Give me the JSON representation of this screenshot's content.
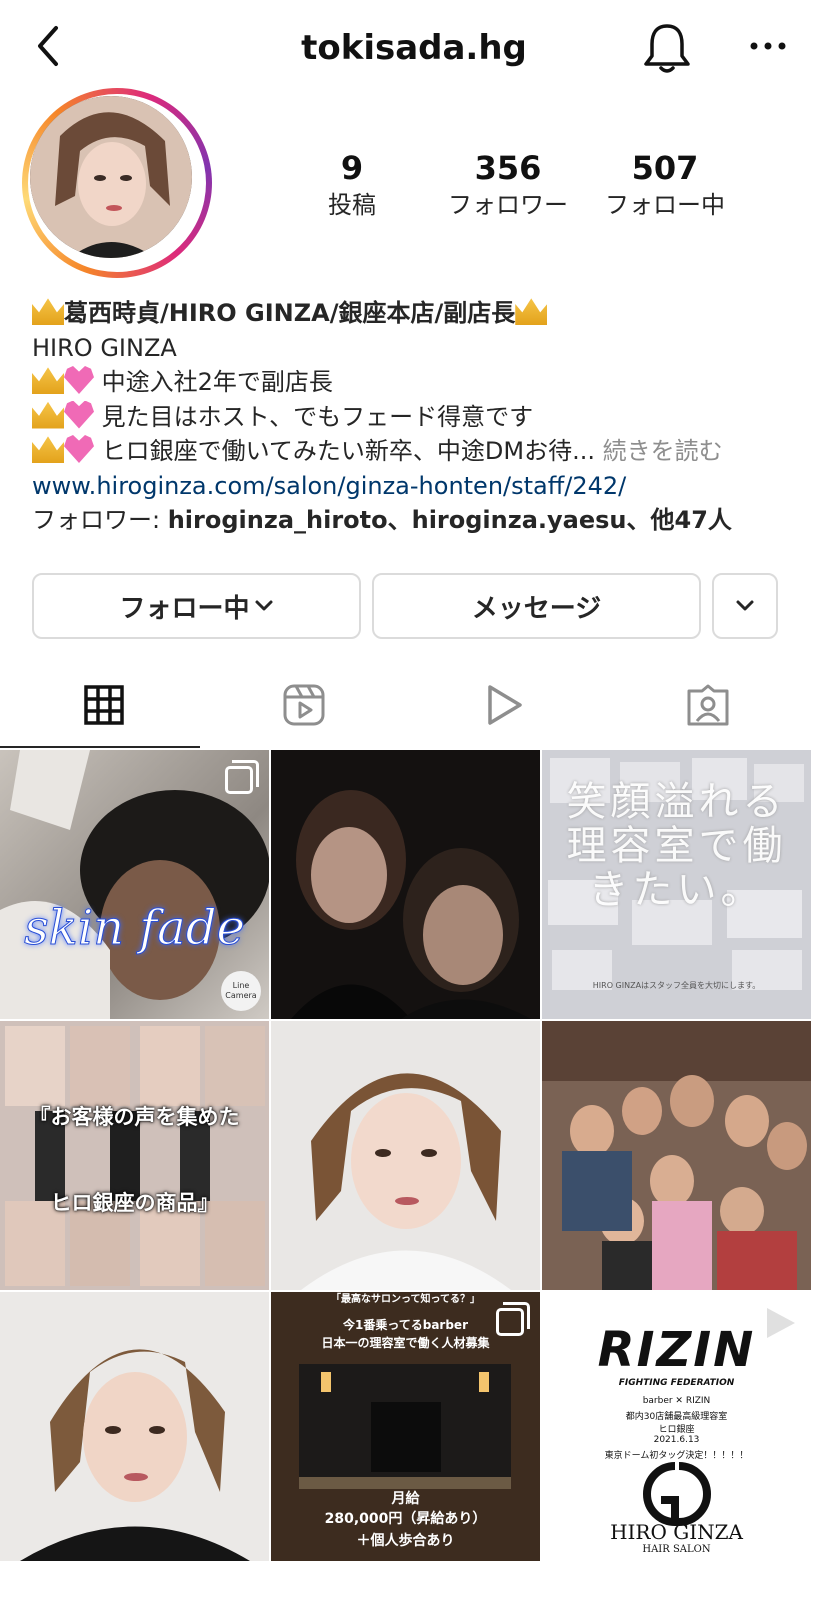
{
  "header": {
    "username": "tokisada.hg"
  },
  "stats": [
    {
      "value": "9",
      "label": "投稿"
    },
    {
      "value": "356",
      "label": "フォロワー"
    },
    {
      "value": "507",
      "label": "フォロー中"
    }
  ],
  "bio": {
    "name": "葛西時貞/HIRO GINZA/銀座本店/副店長",
    "category": "HIRO GINZA",
    "line1": "中途入社2年で副店長",
    "line2": "見た目はホスト、でもフェード得意です",
    "line3": "ヒロ銀座で働いてみたい新卒、中途DMお待...",
    "more": " 続きを読む",
    "link": "www.hiroginza.com/salon/ginza-honten/staff/242/",
    "followed_prefix": "フォロワー: ",
    "followed_names": "hiroginza_hiroto、hiroginza.yaesu、他47人"
  },
  "buttons": {
    "following": "フォロー中",
    "message": "メッセージ"
  },
  "posts": {
    "p1_text": "skin fade",
    "p1_badge": "Line Camera",
    "p3_text": "笑顔溢れる理容室で働きたい。",
    "p3_sub": "HIRO GINZAはスタッフ全員を大切にします。",
    "p4_top": "『お客様の声を集めた",
    "p4_bottom": "ヒロ銀座の商品』",
    "p8_top": "「最高なサロンって知ってる？」",
    "p8_l1": "今1番乗ってるbarber",
    "p8_l2": "日本一の理容室で働く人材募集",
    "p8_l3": "月給",
    "p8_l4": "280,000円（昇給あり）",
    "p8_l5": "＋個人歩合あり",
    "p9_logo": "RIZIN",
    "p9_sub": "FIGHTING FEDERATION",
    "p9_l1": "barber ✕ RIZIN",
    "p9_l2": "都内30店舗最高級理容室",
    "p9_l3": "ヒロ銀座",
    "p9_l4": "2021.6.13",
    "p9_l5": "東京ドーム初タッグ決定！！！！！",
    "p9_brand": "HIRO GINZA",
    "p9_brand_sub": "HAIR SALON"
  },
  "colors": {
    "link": "#00376b",
    "muted": "#8e8e8e",
    "accent": "#dd2a7b"
  }
}
